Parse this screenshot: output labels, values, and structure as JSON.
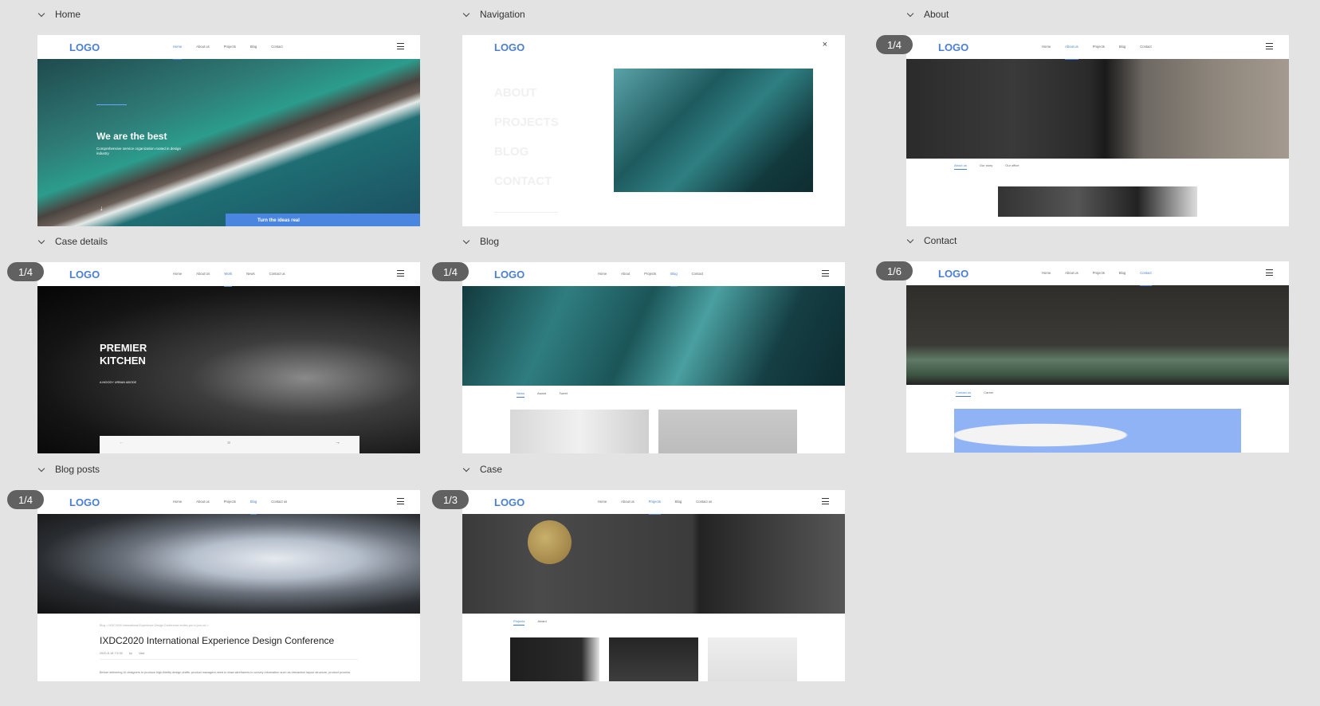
{
  "groups": [
    {
      "id": "home",
      "title": "Home",
      "counter": ""
    },
    {
      "id": "navigation",
      "title": "Navigation",
      "counter": ""
    },
    {
      "id": "about",
      "title": "About",
      "counter": "1/4"
    },
    {
      "id": "case_details",
      "title": "Case details",
      "counter": "1/4"
    },
    {
      "id": "blog",
      "title": "Blog",
      "counter": "1/4"
    },
    {
      "id": "contact",
      "title": "Contact",
      "counter": "1/6"
    },
    {
      "id": "blog_posts",
      "title": "Blog posts",
      "counter": "1/4"
    },
    {
      "id": "case",
      "title": "Case",
      "counter": "1/3"
    }
  ],
  "logo": "LOGO",
  "menus": {
    "home": [
      "Home",
      "About us",
      "Projects",
      "Blog",
      "Contact"
    ],
    "about": [
      "Home",
      "About us",
      "Projects",
      "Blog",
      "Contact"
    ],
    "case_details": [
      "Home",
      "About Us",
      "Work",
      "News",
      "Contact us"
    ],
    "blog": [
      "Home",
      "About",
      "Projects",
      "Blog",
      "Contact"
    ],
    "contact": [
      "Home",
      "About us",
      "Projects",
      "Blog",
      "Contact"
    ],
    "blog_posts": [
      "Home",
      "About us",
      "Projects",
      "Blog",
      "Contact us"
    ],
    "case": [
      "Home",
      "About us",
      "Projects",
      "Blog",
      "Contact us"
    ]
  },
  "home": {
    "headline": "We are the best",
    "sub": "Comprehensive service organization rooted in design industry",
    "cta": "Turn the ideas real"
  },
  "navigation": {
    "links": [
      "ABOUT",
      "PROJECTS",
      "BLOG",
      "CONTACT"
    ]
  },
  "about": {
    "tabs": [
      "About us",
      "Our story",
      "Our office"
    ]
  },
  "case_details": {
    "title1": "PREMIER",
    "title2": "KITCHEN",
    "sub": "A MOODY URBAN ABODE"
  },
  "blog": {
    "tabs": [
      "News",
      "Award",
      "Tweet"
    ]
  },
  "contact": {
    "tabs": [
      "Contact us",
      "Career"
    ]
  },
  "blog_posts": {
    "crumb": "Blog  >  IXDC2020 International Experience Design Conference invites you to join us!  >",
    "title": "IXDC2020 International Experience Design Conference",
    "date": "2020-8-18 7:5:30",
    "by": "by",
    "author": "Vast",
    "body": "Before delivering UI designers to produce high-fidelity design drafts, product managers need to draw wireframes to convey information such as interaction layout structure, product process"
  },
  "case": {
    "tabs": [
      "Projects",
      "Award"
    ]
  },
  "colors": {
    "accent": "#4a7fd1",
    "canvas": "#e3e3e3",
    "counter": "#616161"
  }
}
